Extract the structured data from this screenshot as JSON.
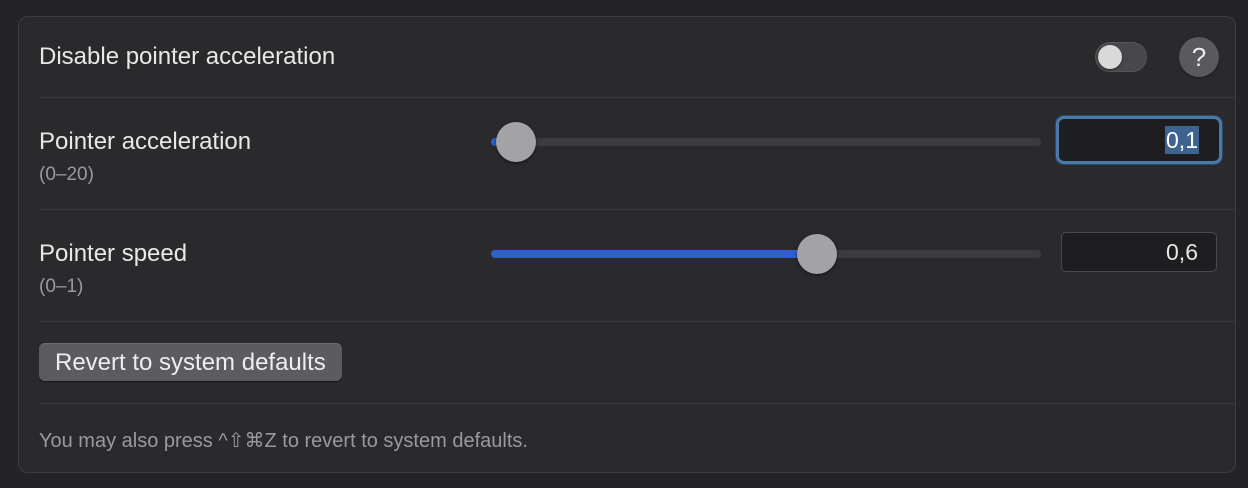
{
  "disable_accel": {
    "label": "Disable pointer acceleration",
    "toggle_on": false,
    "help_symbol": "?"
  },
  "accel": {
    "label": "Pointer acceleration",
    "range": "(0–20)",
    "value_text": "0,1",
    "min": 0,
    "max": 20,
    "value": 0.1
  },
  "speed": {
    "label": "Pointer speed",
    "range": "(0–1)",
    "value_text": "0,6",
    "min": 0,
    "max": 1,
    "value": 0.6
  },
  "revert": {
    "label": "Revert to system defaults"
  },
  "hint": {
    "text": "You may also press ^⇧⌘Z to revert to system defaults."
  },
  "colors": {
    "accent": "#2f5fd0",
    "focus_ring": "#4a78a8"
  },
  "icons": {
    "help": "question-mark-icon"
  }
}
